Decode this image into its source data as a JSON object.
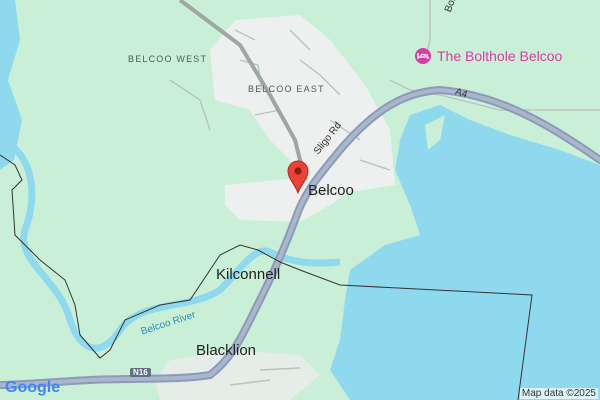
{
  "places": {
    "belcoo_west": "BELCOO WEST",
    "belcoo_east": "BELCOO EAST",
    "belcoo": "Belcoo",
    "kilconnell": "Kilconnell",
    "blacklion": "Blacklion"
  },
  "roads": {
    "sligo_rd": "Sligo Rd",
    "boho_rd": "Boho Rd",
    "a4": "A4",
    "n16": "N16"
  },
  "water": {
    "belcoo_river": "Belcoo River"
  },
  "poi": {
    "name": "The Bolthole Belcoo",
    "icon": "bed-icon"
  },
  "marker": {
    "icon": "map-pin-icon",
    "color": "#ea4335"
  },
  "logo": "Google",
  "attribution": "Map data ©2025",
  "colors": {
    "land": "#c9f0d6",
    "water": "#8fd9ee",
    "road": "#8b9bb8",
    "urban": "#eef0ef",
    "poi": "#d63ea3"
  }
}
